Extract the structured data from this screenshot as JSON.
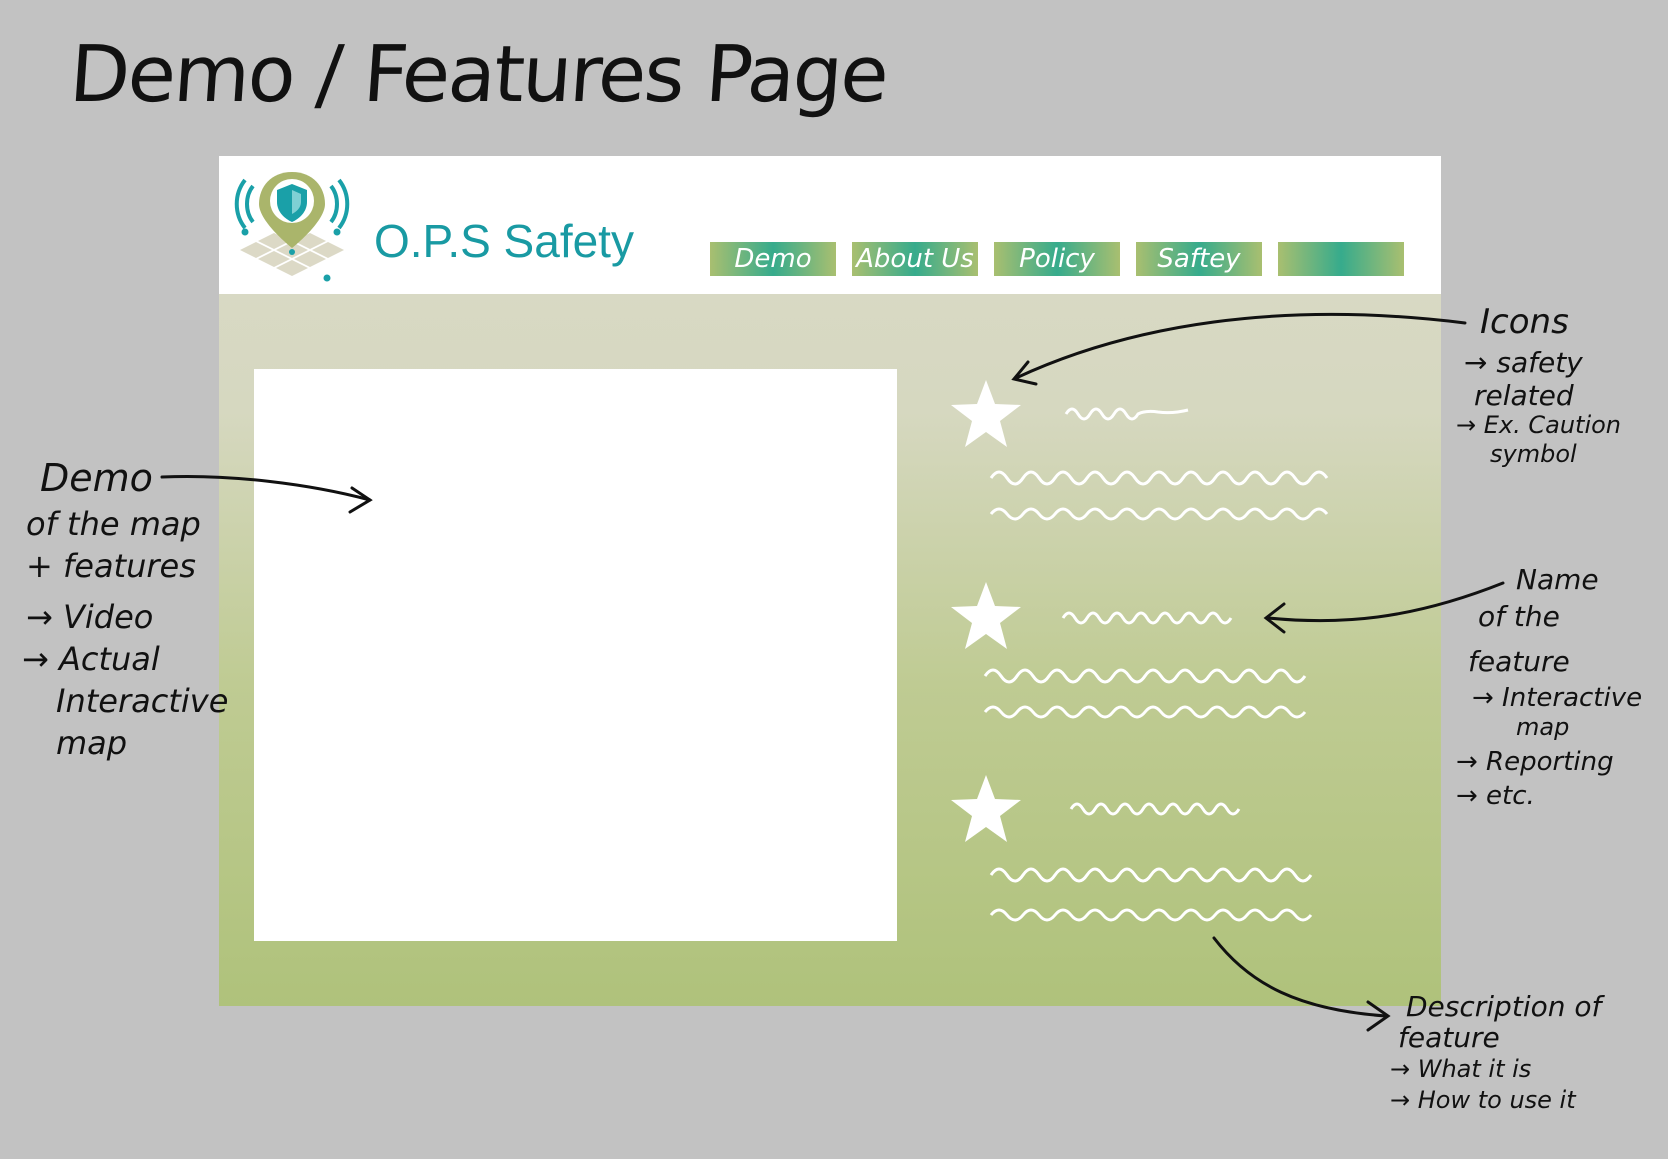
{
  "page_title": "Demo / Features Page",
  "brand": {
    "name": "O.P.S Safety",
    "logo_icon": "map-pin-shield-icon"
  },
  "nav": [
    {
      "label": "Demo"
    },
    {
      "label": "About Us"
    },
    {
      "label": "Policy"
    },
    {
      "label": "Saftey"
    },
    {
      "label": ""
    }
  ],
  "feature_icon": "star-icon",
  "features": [
    {
      "icon": "star-icon"
    },
    {
      "icon": "star-icon"
    },
    {
      "icon": "star-icon"
    }
  ],
  "annotations": {
    "demo": {
      "lines": [
        "Demo",
        "of the map",
        "+ features",
        "→ Video",
        "→ Actual",
        "Interactive",
        "map"
      ]
    },
    "icons": {
      "lines": [
        "Icons",
        "→ safety",
        "related",
        "→ Ex. Caution",
        "symbol"
      ]
    },
    "name": {
      "lines": [
        "Name",
        "of the",
        "feature",
        "→ Interactive",
        "map",
        "→ Reporting",
        "→ etc."
      ]
    },
    "description": {
      "lines": [
        "Description of",
        "feature",
        "→ What it is",
        "→ How to use it"
      ]
    }
  },
  "colors": {
    "background": "#c2c2c2",
    "brand": "#199aa3",
    "nav_green": "#a9bf70",
    "nav_teal": "#36ab8c",
    "mock_top": "#dadac8",
    "mock_bottom": "#afc27b"
  }
}
